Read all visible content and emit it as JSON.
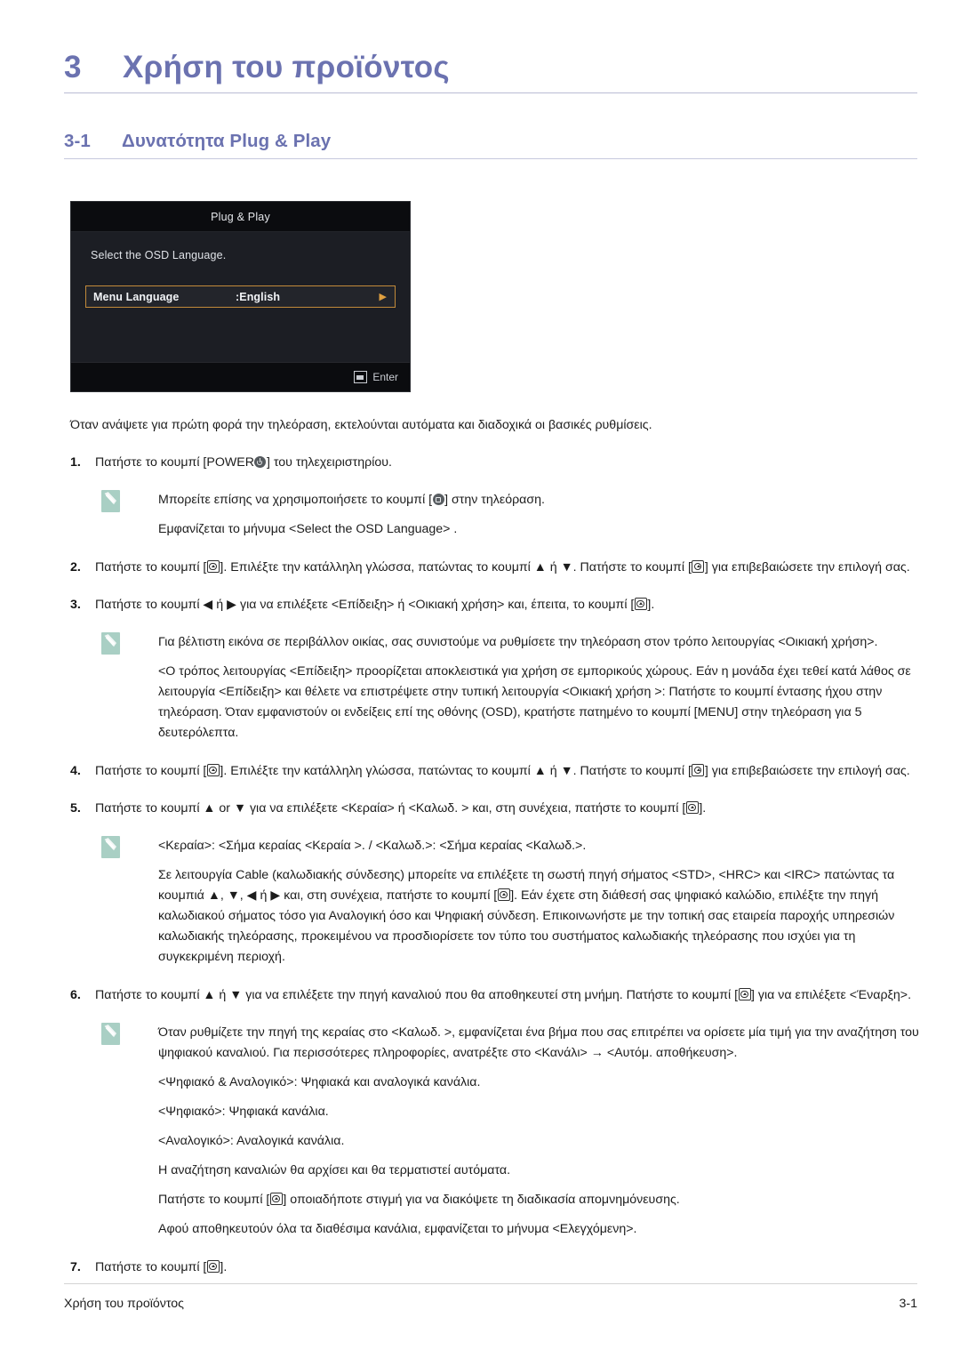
{
  "chapter": {
    "number": "3",
    "title": "Χρήση του προϊόντος"
  },
  "section": {
    "number": "3-1",
    "title": "Δυνατότητα Plug & Play"
  },
  "osd": {
    "title": "Plug & Play",
    "prompt": "Select the OSD Language.",
    "row_label": "Menu Language",
    "row_value": ":English",
    "row_arrow": "▶",
    "enter_label": "Enter"
  },
  "intro": "Όταν ανάψετε για πρώτη φορά την τηλεόραση, εκτελούνται αυτόματα και διαδοχικά οι βασικές ρυθμίσεις.",
  "steps": {
    "s1_num": "1.",
    "s1_a": "Πατήστε το κουμπί [POWER",
    "s1_b": "] του τηλεχειριστηρίου.",
    "n1_a": "Μπορείτε επίσης να χρησιμοποιήσετε το κουμπί [",
    "n1_b": "] στην τηλεόραση.",
    "n1_line2": "Εμφανίζεται το μήνυμα <Select the OSD Language> .",
    "s2_num": "2.",
    "s2_a": "Πατήστε το κουμπί [",
    "s2_b": "]. Επιλέξτε την κατάλληλη γλώσσα, πατώντας το κουμπί ▲ ή ▼. Πατήστε το κουμπί [",
    "s2_c": "] για επιβεβαιώσετε την επιλογή σας.",
    "s3_num": "3.",
    "s3_a": "Πατήστε το κουμπί ◀ ή ▶ για να επιλέξετε <Επίδειξη> ή <Οικιακή χρήση> και, έπειτα, το κουμπί [",
    "s3_b": "].",
    "n2_line1": "Για βέλτιστη εικόνα σε περιβάλλον οικίας, σας συνιστούμε να ρυθμίσετε την τηλεόραση στον τρόπο λειτουργίας <Οικιακή χρήση>.",
    "n2_line2": "<Ο τρόπος λειτουργίας <Επίδειξη> προορίζεται αποκλειστικά για χρήση σε εμπορικούς χώρους. Εάν η μονάδα έχει τεθεί κατά λάθος σε λειτουργία <Επίδειξη> και θέλετε να επιστρέψετε στην τυπική λειτουργία <Οικιακή χρήση >: Πατήστε το κουμπί έντασης ήχου στην τηλεόραση. Όταν εμφανιστούν οι ενδείξεις επί της οθόνης (OSD), κρατήστε πατημένο το κουμπί [MENU] στην τηλεόραση για 5 δευτερόλεπτα.",
    "s4_num": "4.",
    "s4_a": "Πατήστε το κουμπί [",
    "s4_b": "]. Επιλέξτε την κατάλληλη γλώσσα, πατώντας το κουμπί ▲ ή ▼. Πατήστε το κουμπί [",
    "s4_c": "] για επιβεβαιώσετε την επιλογή σας.",
    "s5_num": "5.",
    "s5_a": "Πατήστε το κουμπί ▲ or ▼ για να επιλέξετε <Κεραία> ή <Καλωδ. > και, στη συνέχεια, πατήστε το κουμπί [",
    "s5_b": "].",
    "n3_line1": "<Κεραία>: <Σήμα κεραίας <Κεραία >. / <Καλωδ.>: <Σήμα κεραίας <Καλωδ.>.",
    "n3_line2a": "Σε λειτουργία Cable (καλωδιακής σύνδεσης) μπορείτε να επιλέξετε τη σωστή πηγή σήματος <STD>, <HRC> και <IRC> πατώντας τα κουμπιά ▲, ▼, ◀ ή ▶ και, στη συνέχεια, πατήστε το κουμπί [",
    "n3_line2b": "]. Εάν έχετε στη διάθεσή σας ψηφιακό καλώδιο, επιλέξτε την πηγή καλωδιακού σήματος τόσο για Αναλογική όσο και Ψηφιακή σύνδεση. Επικοινωνήστε με την τοπική σας εταιρεία παροχής υπηρεσιών καλωδιακής τηλεόρασης, προκειμένου να προσδιορίσετε τον τύπο του συστήματος καλωδιακής τηλεόρασης που ισχύει για τη συγκεκριμένη περιοχή.",
    "s6_num": "6.",
    "s6_a": "Πατήστε το κουμπί ▲ ή ▼ για να επιλέξετε την πηγή καναλιού που θα αποθηκευτεί στη μνήμη. Πατήστε το κουμπί [",
    "s6_b": "] για να επιλέξετε <Έναρξη>.",
    "n4_line1": "Όταν ρυθμίζετε την πηγή της κεραίας στο <Καλωδ. >, εμφανίζεται ένα βήμα που σας επιτρέπει να ορίσετε μία τιμή για την αναζήτηση του ψηφιακού καναλιού. Για περισσότερες πληροφορίες, ανατρέξτε στο <Κανάλι> → <Αυτόμ. αποθήκευση>.",
    "n4_line2": "<Ψηφιακό & Αναλογικό>: Ψηφιακά και αναλογικά κανάλια.",
    "n4_line3": "<Ψηφιακό>: Ψηφιακά κανάλια.",
    "n4_line4": "<Αναλογικό>: Αναλογικά κανάλια.",
    "n4_line5": "Η αναζήτηση καναλιών θα αρχίσει και θα τερματιστεί αυτόματα.",
    "n4_line6a": "Πατήστε το κουμπί [",
    "n4_line6b": "] οποιαδήποτε στιγμή για να διακόψετε τη διαδικασία απομνημόνευσης.",
    "n4_line7": "Αφού αποθηκευτούν όλα τα διαθέσιμα κανάλια, εμφανίζεται το μήνυμα <Ελεγχόμενη>.",
    "s7_num": "7.",
    "s7_a": "Πατήστε το κουμπί [",
    "s7_b": "]."
  },
  "footer": {
    "left": "Χρήση του προϊόντος",
    "right": "3-1"
  },
  "colors": {
    "heading": "#6b72b0",
    "osd_highlight": "#c28a3a",
    "note_icon": "#a9cfc4"
  }
}
